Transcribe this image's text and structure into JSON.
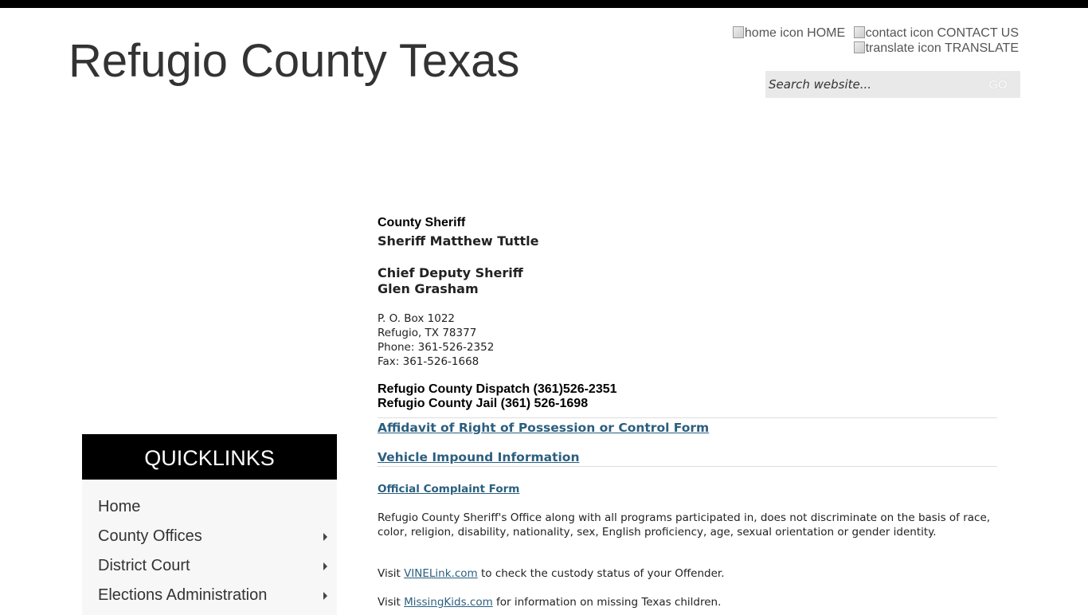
{
  "site": {
    "title": "Refugio County Texas"
  },
  "util_nav": {
    "home": {
      "icon_alt": "home icon",
      "label": "HOME"
    },
    "contact": {
      "icon_alt": "contact icon",
      "label": "CONTACT US"
    },
    "translate": {
      "icon_alt": "translate icon",
      "label": "TRANSLATE"
    }
  },
  "search": {
    "placeholder": "Search website...",
    "button_label": "GO"
  },
  "quicklinks": {
    "title": "QUICKLINKS",
    "items": [
      {
        "label": "Home",
        "has_submenu": false
      },
      {
        "label": "County Offices",
        "has_submenu": true
      },
      {
        "label": "District Court",
        "has_submenu": true
      },
      {
        "label": "Elections Administration",
        "has_submenu": true
      }
    ]
  },
  "content": {
    "heading": "County Sheriff",
    "sheriff_name": "Sheriff Matthew Tuttle",
    "chief_deputy_title": "Chief Deputy Sheriff",
    "chief_deputy_name": "Glen Grasham",
    "address": [
      "P. O. Box 1022",
      "Refugio, TX 78377",
      "Phone: 361-526-2352",
      "Fax: 361-526-1668"
    ],
    "dispatch": "Refugio County Dispatch (361)526-2351",
    "jail": "Refugio County Jail (361) 526-1698",
    "links": {
      "affidavit": "Affidavit of Right of Possession or Control Form",
      "impound": "Vehicle Impound Information",
      "complaint": "Official Complaint Form"
    },
    "nondiscrimination": "Refugio County Sheriff's Office along with all programs participated in, does not discriminate on the basis of race, color, religion, disability, nationality, sex, English proficiency, age, sexual orientation or gender identity.",
    "vine": {
      "prefix": "Visit ",
      "link": "VINELink.com",
      "suffix": " to check the custody status of your Offender."
    },
    "missing": {
      "prefix": "Visit ",
      "link": "MissingKids.com",
      "suffix": " for information on missing Texas children."
    }
  }
}
